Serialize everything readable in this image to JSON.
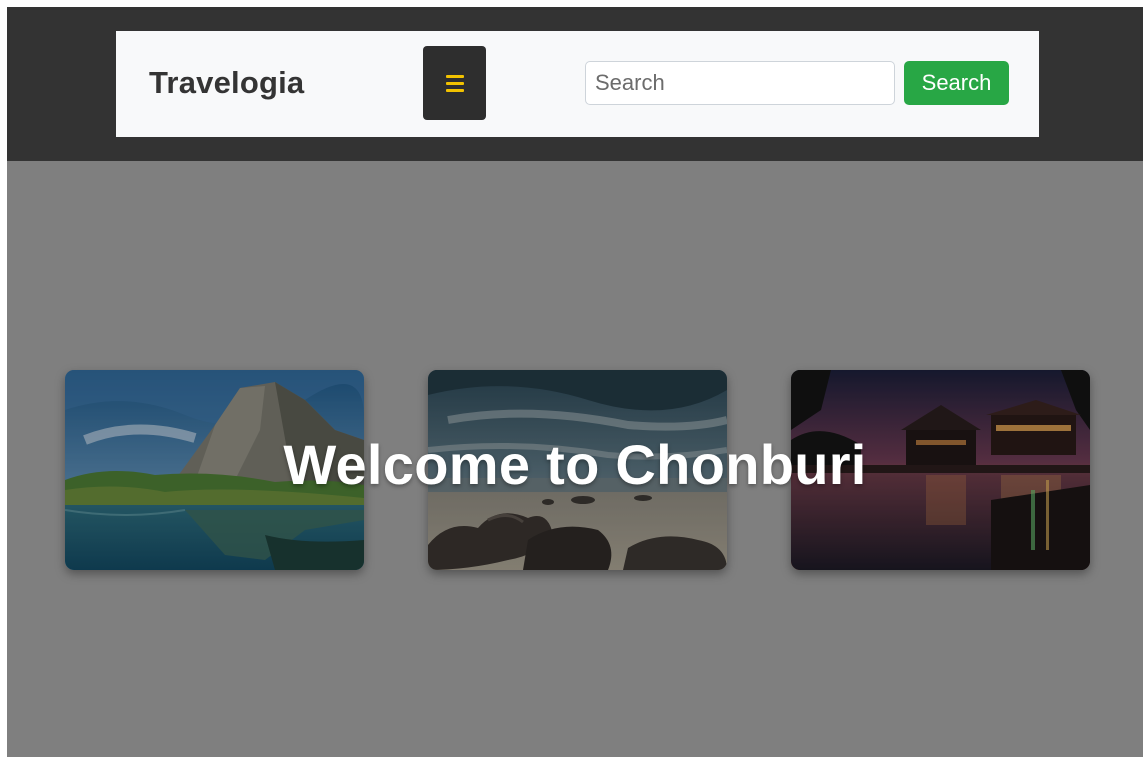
{
  "navbar": {
    "brand": "Travelogia",
    "menu_icon": "hamburger-menu-icon",
    "search_placeholder": "Search",
    "search_value": "",
    "search_button_label": "Search"
  },
  "hero": {
    "title": "Welcome to Chonburi"
  },
  "cards": [
    {
      "image": "mountain-lake-image"
    },
    {
      "image": "rocky-beach-image"
    },
    {
      "image": "night-waterfront-image"
    }
  ],
  "colors": {
    "topbar": "#333333",
    "navbar_bg": "#f8f9fa",
    "page_bg": "#7f7f7f",
    "menu_button": "#2e2e2e",
    "menu_icon": "#f2c200",
    "search_button": "#28a745",
    "title_text": "#ffffff"
  }
}
